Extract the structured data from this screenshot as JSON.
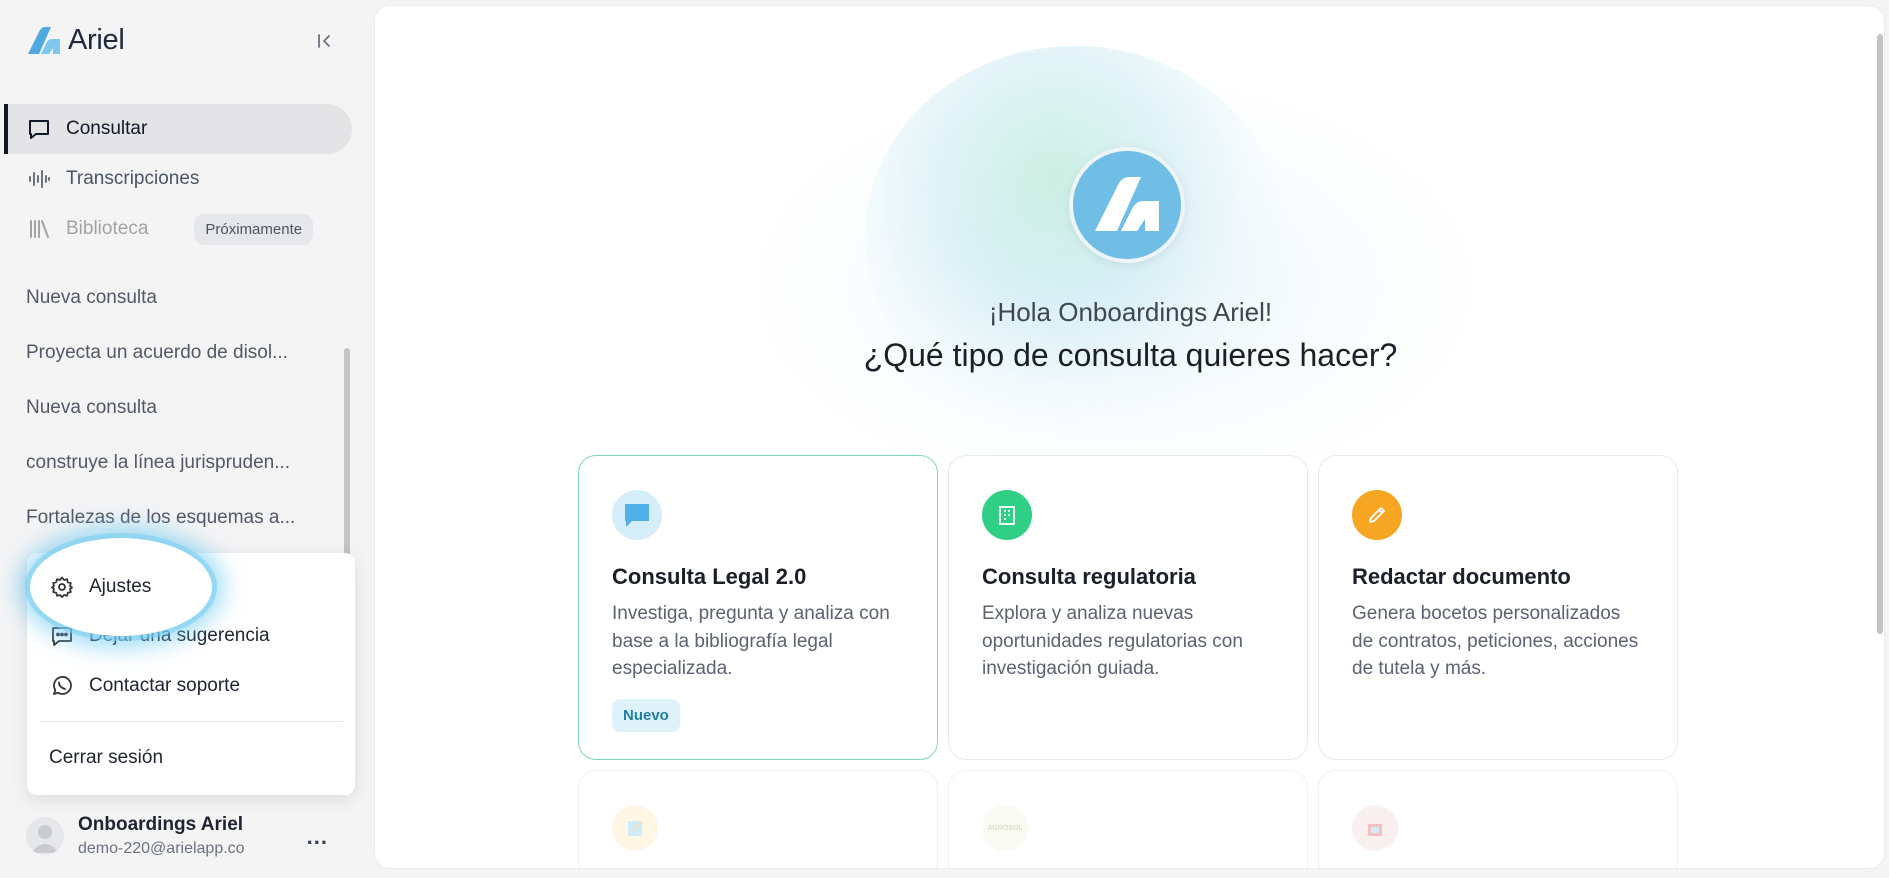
{
  "app": {
    "name": "Ariel"
  },
  "nav": {
    "items": [
      {
        "label": "Consultar",
        "icon": "chat-bubble-icon",
        "active": true
      },
      {
        "label": "Transcripciones",
        "icon": "waveform-icon"
      },
      {
        "label": "Biblioteca",
        "icon": "library-icon",
        "disabled": true,
        "badge": "Próximamente"
      }
    ]
  },
  "history": [
    "Nueva consulta",
    "Proyecta un acuerdo de disol...",
    "Nueva consulta",
    "construye la línea jurispruden...",
    "Fortalezas de los esquemas a..."
  ],
  "menu": {
    "settings": "Ajustes",
    "feedback": "Dejar una sugerencia",
    "support": "Contactar soporte",
    "logout": "Cerrar sesión"
  },
  "user": {
    "name": "Onboardings Ariel",
    "email": "demo-220@arielapp.co",
    "more": "..."
  },
  "main": {
    "greeting": "¡Hola Onboardings Ariel!",
    "question": "¿Qué tipo de consulta quieres hacer?",
    "cards": [
      {
        "title": "Consulta Legal 2.0",
        "description": "Investiga, pregunta y analiza con base a la bibliografía legal especializada.",
        "badge": "Nuevo",
        "icon": "chat-bubble-icon",
        "color": "#7cc8ee"
      },
      {
        "title": "Consulta regulatoria",
        "description": "Explora y analiza nuevas oportunidades regulatorias con investigación guiada.",
        "icon": "building-icon",
        "color": "#2fcf85"
      },
      {
        "title": "Redactar documento",
        "description": "Genera bocetos personalizados de contratos, peticiones, acciones de tutela y más.",
        "icon": "pencil-icon",
        "color": "#f6a623"
      }
    ],
    "more_cards": [
      {
        "icon": "notepad-icon"
      },
      {
        "icon": "agrosol-logo-icon",
        "logo_text": "AGROSOL"
      },
      {
        "icon": "store-icon"
      }
    ]
  },
  "colors": {
    "accent": "#70bde6",
    "active_bg": "#e4e4e7",
    "selected_border": "#7ed6c4"
  }
}
